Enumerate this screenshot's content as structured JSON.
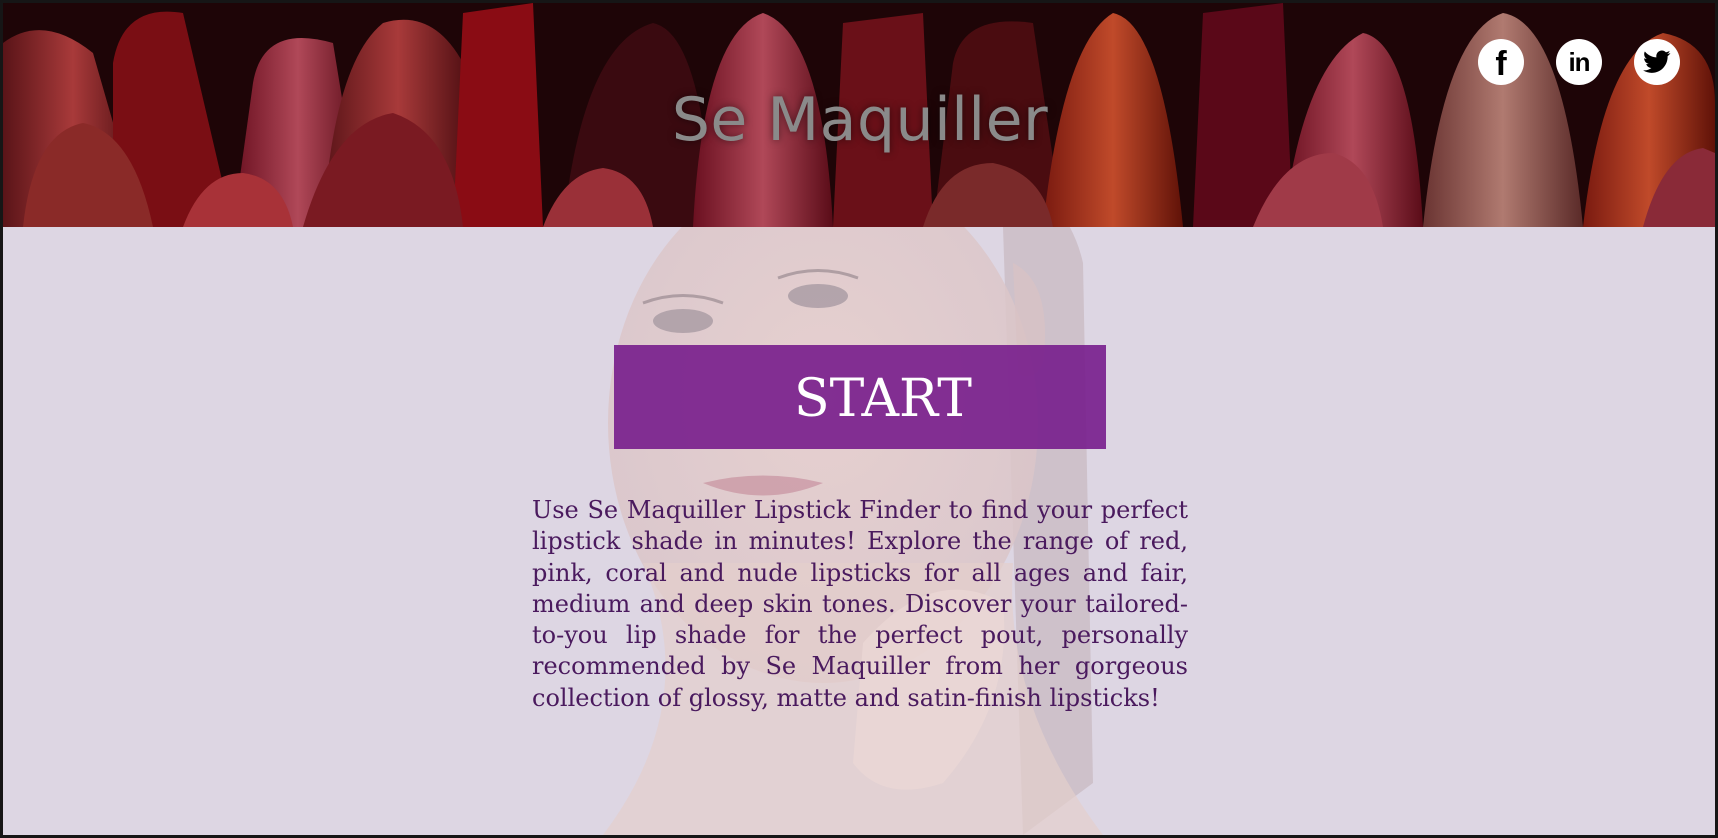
{
  "header": {
    "title": "Se Maquiller",
    "background_image": "lipstick-collection-banner",
    "social": [
      {
        "name": "facebook",
        "icon": "facebook-icon",
        "glyph": "f"
      },
      {
        "name": "linkedin",
        "icon": "linkedin-icon",
        "glyph": "in"
      },
      {
        "name": "twitter",
        "icon": "twitter-icon",
        "glyph": ""
      }
    ]
  },
  "main": {
    "background_image": "woman-portrait",
    "start_label": "START",
    "description": "Use Se Maquiller Lipstick Finder to find your perfect lipstick shade in minutes! Explore the range of red, pink, coral and nude lipsticks for all ages and fair, medium and deep skin tones. Discover your tailored-to-you lip shade for the perfect pout, personally recommended by Se Maquiller from her gorgeous collection of glossy, matte and satin-finish lipsticks!"
  },
  "colors": {
    "accent": "#74188a",
    "background": "#ddd6e3",
    "text": "#4a1a5e",
    "title": "#8a8a8a"
  }
}
